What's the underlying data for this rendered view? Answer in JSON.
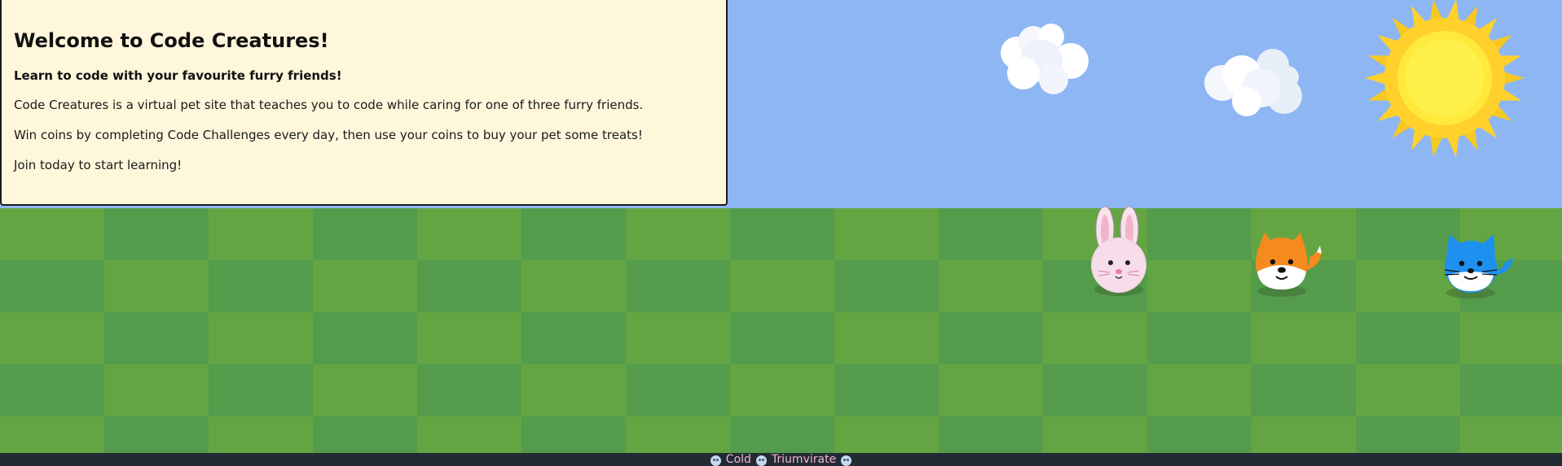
{
  "info": {
    "title": "Welcome to Code Creatures!",
    "subtitle": "Learn to code with your favourite furry friends!",
    "paragraphs": [
      "Code Creatures is a virtual pet site that teaches you to code while caring for one of three furry friends.",
      "Win coins by completing Code Challenges every day, then use your coins to buy your pet some treats!",
      "Join today to start learning!"
    ]
  },
  "pets": [
    {
      "name": "bunny",
      "color": "#f2d6e4"
    },
    {
      "name": "fox",
      "color": "#f68a1f"
    },
    {
      "name": "cat",
      "color": "#1e90f0"
    }
  ],
  "scene": {
    "sky_color": "#8db6f3",
    "grass_light": "#63a542",
    "grass_dark": "#549c4b",
    "sun_color": "#ffe93b"
  },
  "footer": {
    "items": [
      "Cold",
      "Triumvirate"
    ],
    "text_color": "#f4b2d4"
  }
}
